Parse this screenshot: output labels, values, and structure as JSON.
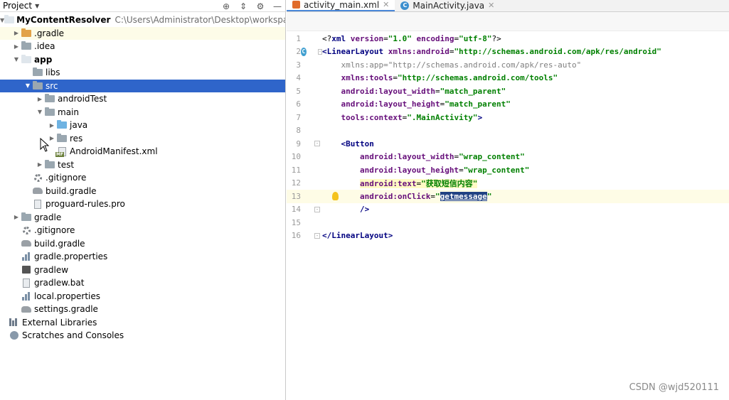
{
  "panel": {
    "title": "Project",
    "tree": [
      {
        "label": "MyContentResolver",
        "hint": "C:\\Users\\Administrator\\Desktop\\workspace\\MyCo",
        "indent": 0,
        "arrow": "down",
        "icon": "folder-white",
        "bold": true
      },
      {
        "label": ".gradle",
        "indent": 1,
        "arrow": "right",
        "icon": "folder-orange",
        "highlight": true
      },
      {
        "label": ".idea",
        "indent": 1,
        "arrow": "right",
        "icon": "folder"
      },
      {
        "label": "app",
        "indent": 1,
        "arrow": "down",
        "icon": "folder-white",
        "bold": true
      },
      {
        "label": "libs",
        "indent": 2,
        "arrow": "",
        "icon": "folder"
      },
      {
        "label": "src",
        "indent": 2,
        "arrow": "down",
        "icon": "folder",
        "selected": true
      },
      {
        "label": "androidTest",
        "indent": 3,
        "arrow": "right",
        "icon": "folder"
      },
      {
        "label": "main",
        "indent": 3,
        "arrow": "down",
        "icon": "folder"
      },
      {
        "label": "java",
        "indent": 4,
        "arrow": "right",
        "icon": "folder-blue"
      },
      {
        "label": "res",
        "indent": 4,
        "arrow": "right",
        "icon": "folder"
      },
      {
        "label": "AndroidManifest.xml",
        "indent": 4,
        "arrow": "",
        "icon": "manifest"
      },
      {
        "label": "test",
        "indent": 3,
        "arrow": "right",
        "icon": "folder"
      },
      {
        "label": ".gitignore",
        "indent": 2,
        "arrow": "",
        "icon": "gear"
      },
      {
        "label": "build.gradle",
        "indent": 2,
        "arrow": "",
        "icon": "elephant"
      },
      {
        "label": "proguard-rules.pro",
        "indent": 2,
        "arrow": "",
        "icon": "file"
      },
      {
        "label": "gradle",
        "indent": 1,
        "arrow": "right",
        "icon": "folder"
      },
      {
        "label": ".gitignore",
        "indent": 1,
        "arrow": "",
        "icon": "gear"
      },
      {
        "label": "build.gradle",
        "indent": 1,
        "arrow": "",
        "icon": "elephant"
      },
      {
        "label": "gradle.properties",
        "indent": 1,
        "arrow": "",
        "icon": "bars"
      },
      {
        "label": "gradlew",
        "indent": 1,
        "arrow": "",
        "icon": "term"
      },
      {
        "label": "gradlew.bat",
        "indent": 1,
        "arrow": "",
        "icon": "file"
      },
      {
        "label": "local.properties",
        "indent": 1,
        "arrow": "",
        "icon": "bars"
      },
      {
        "label": "settings.gradle",
        "indent": 1,
        "arrow": "",
        "icon": "elephant"
      },
      {
        "label": "External Libraries",
        "indent": 0,
        "arrow": "",
        "icon": "library"
      },
      {
        "label": "Scratches and Consoles",
        "indent": 0,
        "arrow": "",
        "icon": "scratch"
      }
    ]
  },
  "tabs": [
    {
      "label": "activity_main.xml",
      "icon": "xml-icon",
      "active": true
    },
    {
      "label": "MainActivity.java",
      "icon": "class-icon",
      "active": false
    }
  ],
  "code": {
    "lines": [
      {
        "n": "1",
        "html": "<span class='pi'>&lt;?</span><span class='tag'>xml </span><span class='attr'>version</span>=<span class='val'>\"1.0\"</span> <span class='attr'>encoding</span>=<span class='val'>\"utf-8\"</span><span class='pi'>?&gt;</span>"
      },
      {
        "n": "2",
        "html": "<span class='tag'>&lt;LinearLayout </span><span class='attr'>xmlns:android</span>=<span class='val'>\"http://schemas.android.com/apk/res/android\"</span>",
        "classIcon": true,
        "fold": true
      },
      {
        "n": "3",
        "html": "    <span class='attrg'>xmlns:app</span><span class='attrg'>=\"http://schemas.android.com/apk/res-auto\"</span>"
      },
      {
        "n": "4",
        "html": "    <span class='attr'>xmlns:tools</span>=<span class='val'>\"http://schemas.android.com/tools\"</span>"
      },
      {
        "n": "5",
        "html": "    <span class='attr'>android:layout_width</span>=<span class='val'>\"match_parent\"</span>"
      },
      {
        "n": "6",
        "html": "    <span class='attr'>android:layout_height</span>=<span class='val'>\"match_parent\"</span>"
      },
      {
        "n": "7",
        "html": "    <span class='attr'>tools:context</span>=<span class='val'>\".MainActivity\"</span><span class='tag'>&gt;</span>"
      },
      {
        "n": "8",
        "html": ""
      },
      {
        "n": "9",
        "html": "    <span class='tag'>&lt;Button</span>",
        "fold": true
      },
      {
        "n": "10",
        "html": "        <span class='attr'>android:layout_width</span>=<span class='val'>\"wrap_content\"</span>"
      },
      {
        "n": "11",
        "html": "        <span class='attr'>android:layout_height</span>=<span class='val'>\"wrap_content\"</span>"
      },
      {
        "n": "12",
        "html": "        <span class='hl-attr'><span class='attr'>android:text</span>=<span class='val'>\"获取短信内容\"</span></span>"
      },
      {
        "n": "13",
        "html": "        <span class='attr'>android:onClick</span>=<span class='val'>\"<span class='selection'>getmessage</span>\"</span>",
        "current": true,
        "bulb": true
      },
      {
        "n": "14",
        "html": "        <span class='tag'>/&gt;</span>",
        "fold": true
      },
      {
        "n": "15",
        "html": ""
      },
      {
        "n": "16",
        "html": "<span class='tag'>&lt;/LinearLayout&gt;</span>",
        "fold": true
      }
    ]
  },
  "watermark": "CSDN @wjd520111"
}
